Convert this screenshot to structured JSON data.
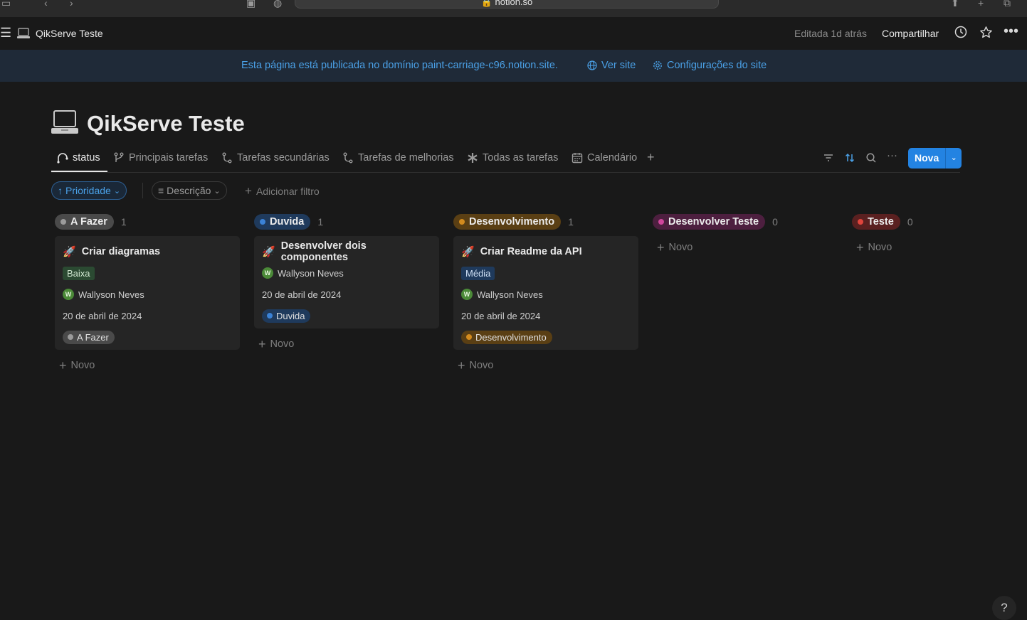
{
  "browser": {
    "url": "notion.so"
  },
  "topbar": {
    "page_title": "QikServe Teste",
    "edited": "Editada 1d atrás",
    "share": "Compartilhar"
  },
  "banner": {
    "message": "Esta página está publicada no domínio paint-carriage-c96.notion.site.",
    "view_site": "Ver site",
    "site_settings": "Configurações do site"
  },
  "page": {
    "title": "QikServe Teste"
  },
  "tabs": [
    {
      "label": "status"
    },
    {
      "label": "Principais tarefas"
    },
    {
      "label": "Tarefas secundárias"
    },
    {
      "label": "Tarefas de melhorias"
    },
    {
      "label": "Todas as tarefas"
    },
    {
      "label": "Calendário"
    }
  ],
  "toolbar": {
    "new_label": "Nova"
  },
  "filters": {
    "priority": "Prioridade",
    "description": "Descrição",
    "add_filter": "Adicionar filtro"
  },
  "new_label": "Novo",
  "columns": [
    {
      "name": "A Fazer",
      "count": "1",
      "color": "#9b9b9b",
      "bg": "#4a4a4a",
      "cards": [
        {
          "title": "Criar diagramas",
          "priority": "Baixa",
          "assignee": "Wallyson Neves",
          "avatar": "W",
          "date": "20 de abril de 2024",
          "status": "A Fazer"
        }
      ]
    },
    {
      "name": "Duvida",
      "count": "1",
      "color": "#3b82d6",
      "bg": "#1f3a5c",
      "cards": [
        {
          "title": "Desenvolver dois componentes",
          "assignee": "Wallyson Neves",
          "avatar": "W",
          "date": "20 de abril de 2024",
          "status": "Duvida"
        }
      ]
    },
    {
      "name": "Desenvolvimento",
      "count": "1",
      "color": "#d38b1e",
      "bg": "#5a3f14",
      "cards": [
        {
          "title": "Criar Readme da API",
          "priority": "Média",
          "assignee": "Wallyson Neves",
          "avatar": "W",
          "date": "20 de abril de 2024",
          "status": "Desenvolvimento"
        }
      ]
    },
    {
      "name": "Desenvolver Teste",
      "count": "0",
      "color": "#d0469c",
      "bg": "#4d1f3f",
      "cards": []
    },
    {
      "name": "Teste",
      "count": "0",
      "color": "#e0453d",
      "bg": "#5a2020",
      "cards": []
    }
  ],
  "help": "?"
}
